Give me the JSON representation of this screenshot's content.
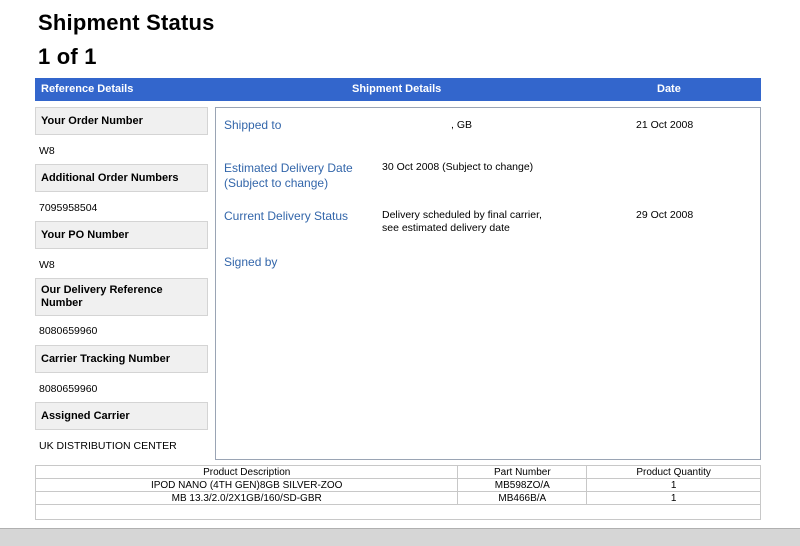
{
  "page": {
    "title": "Shipment Status",
    "pagination": "1 of 1"
  },
  "header_bar": {
    "reference": "Reference Details",
    "shipment": "Shipment Details",
    "date": "Date"
  },
  "reference": [
    {
      "label": "Your Order Number",
      "value": "W8"
    },
    {
      "label": "Additional Order Numbers",
      "value": "7095958504"
    },
    {
      "label": "Your PO Number",
      "value": "W8"
    },
    {
      "label": "Our Delivery Reference Number",
      "value": "8080659960"
    },
    {
      "label": "Carrier Tracking Number",
      "value": "8080659960"
    },
    {
      "label": "Assigned Carrier",
      "value": "UK DISTRIBUTION CENTER"
    }
  ],
  "shipment": {
    "shipped_to": {
      "label": "Shipped to",
      "value": ", GB",
      "date": "21 Oct 2008"
    },
    "estimated": {
      "label_line1": "Estimated Delivery Date",
      "label_line2": "(Subject to change)",
      "value": "30 Oct 2008 (Subject to change)"
    },
    "status": {
      "label": "Current Delivery Status",
      "value_line1": "Delivery scheduled by final carrier,",
      "value_line2": "see estimated delivery date",
      "date": "29 Oct 2008"
    },
    "signed": {
      "label": "Signed by"
    }
  },
  "products": {
    "headers": [
      "Product Description",
      "Part Number",
      "Product Quantity"
    ],
    "rows": [
      {
        "description": "IPOD NANO (4TH GEN)8GB SILVER-ZOO",
        "part": "MB598ZO/A",
        "qty": "1"
      },
      {
        "description": "MB 13.3/2.0/2X1GB/160/SD-GBR",
        "part": "MB466B/A",
        "qty": "1"
      }
    ]
  }
}
